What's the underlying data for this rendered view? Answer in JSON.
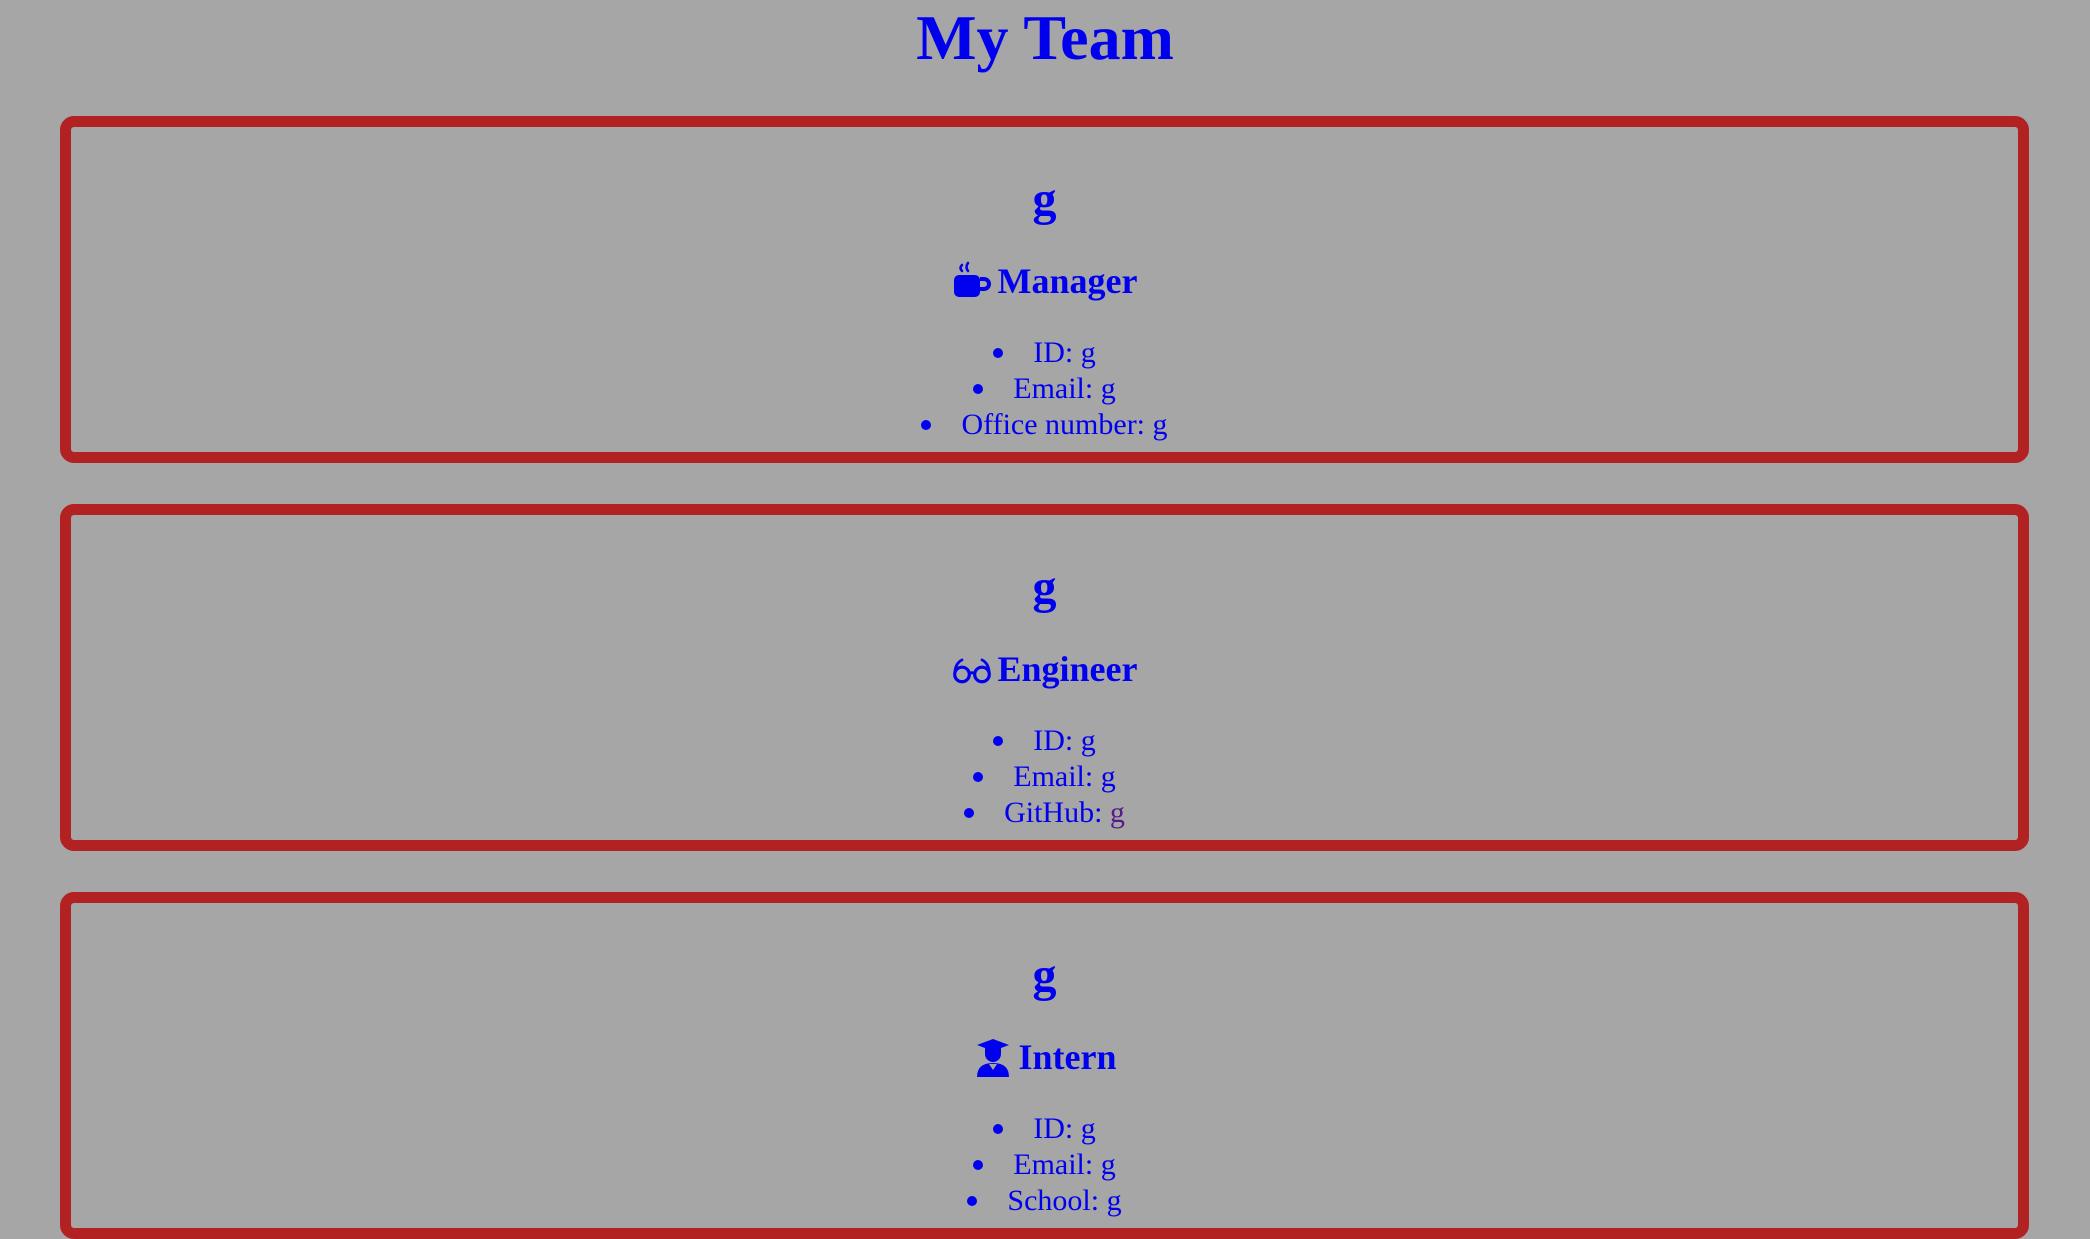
{
  "page": {
    "title": "My Team"
  },
  "colors": {
    "background": "#a6a6a6",
    "text": "#0000ee",
    "card_border": "#b22222",
    "visited_link": "#551a8b"
  },
  "cards": [
    {
      "name": "g",
      "role": "Manager",
      "icon": "coffee-mug-icon",
      "details": [
        {
          "label": "ID: ",
          "value": "g"
        },
        {
          "label": "Email: ",
          "value": "g"
        },
        {
          "label": "Office number: ",
          "value": "g"
        }
      ]
    },
    {
      "name": "g",
      "role": "Engineer",
      "icon": "glasses-icon",
      "details": [
        {
          "label": "ID: ",
          "value": "g"
        },
        {
          "label": "Email: ",
          "value": "g"
        },
        {
          "label": "GitHub: ",
          "value": "g"
        }
      ]
    },
    {
      "name": "g",
      "role": "Intern",
      "icon": "graduate-icon",
      "details": [
        {
          "label": "ID: ",
          "value": "g"
        },
        {
          "label": "Email: ",
          "value": "g"
        },
        {
          "label": "School: ",
          "value": "g"
        }
      ]
    }
  ]
}
